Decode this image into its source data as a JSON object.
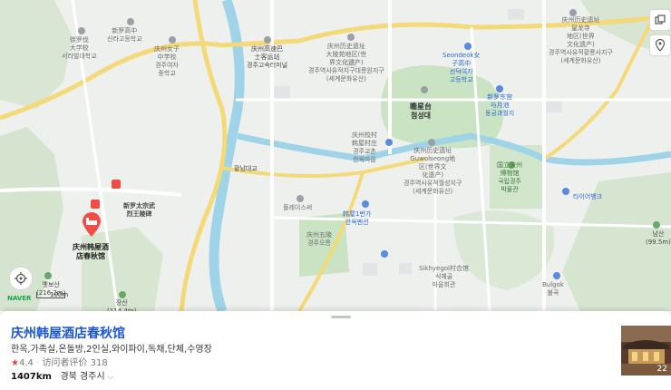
{
  "map": {
    "labels": {
      "school1": "新罗高中\n신라고등학교",
      "school2": "徐罗伐\n大学校\n서라벌대학교",
      "school3": "庆州女子\n中学校\n경주여자\n중학교",
      "bus_terminal": "庆州高速巴\n士客运站\n경주고속터미널",
      "heritage1": "庆州历史遗址\n大陵苑地区(世\n界文化遗产)\n경주역사유적지구대릉원지구\n(세계문화유산)",
      "heritage2": "庆州历史遗址\n皇龙寺\n地区(世界\n文化遗产)\n경주역사유적황룡사지구\n(세계문화유산)",
      "seondeok": "Seondeok女\n子高中\n선덕여자\n고등학교",
      "cheomseongdae": "瞻星台\n첨성대",
      "hanok_village": "庆州校村\n韩屋村庄\n경주교촌\n한옥마을",
      "wolseong": "庆州历史遗址\nGuwolseong地\n区(世界文\n化遗产)\n경주역사유적월성지구\n(세계문화유산)",
      "middle_school": "新罗东宫\n与月池\n동궁과월지",
      "museum": "国立庆州\n博物馆\n국립경주\n박물관",
      "bridge": "황남대교",
      "plaza": "플레이스써",
      "tomb": "庆州五陵\n경주오릉",
      "guesthouse": "韩屋1번가\n한옥펜션",
      "sikhye": "Sikhyegol村合馆\n식혜골\n마을회관",
      "tire": "타이어뱅크",
      "namsan": "남산\n(99.5m)",
      "bulgok": "Bulgok\n불곡",
      "tomb2": "新罗太宗武\n烈王陵碑",
      "mountain_left": "옛보산\n(216.2m)",
      "mountain_bottom": "장산\n(114.4m)",
      "hotel": "庆州韩屋酒\n店春秋馆",
      "naver": "NAVER",
      "scale": "100m",
      "nav_arrow": "⊕"
    }
  },
  "place": {
    "title": "庆州韩屋酒店春秋馆",
    "tags": "한옥,가족실,온돌방,2인실,와이파이,독채,단체,수영장",
    "rating_value": "4.4",
    "reviews_label": "访问者评价 318",
    "distance": "1407km",
    "region": "경북 경주시",
    "photo_count": "22"
  },
  "colors": {
    "accent_blue": "#1a55d6",
    "marker_red": "#ef4d45",
    "road_yellow": "#f4d978",
    "river_blue": "#9ed3e8",
    "park_green": "#c9e3c3"
  }
}
